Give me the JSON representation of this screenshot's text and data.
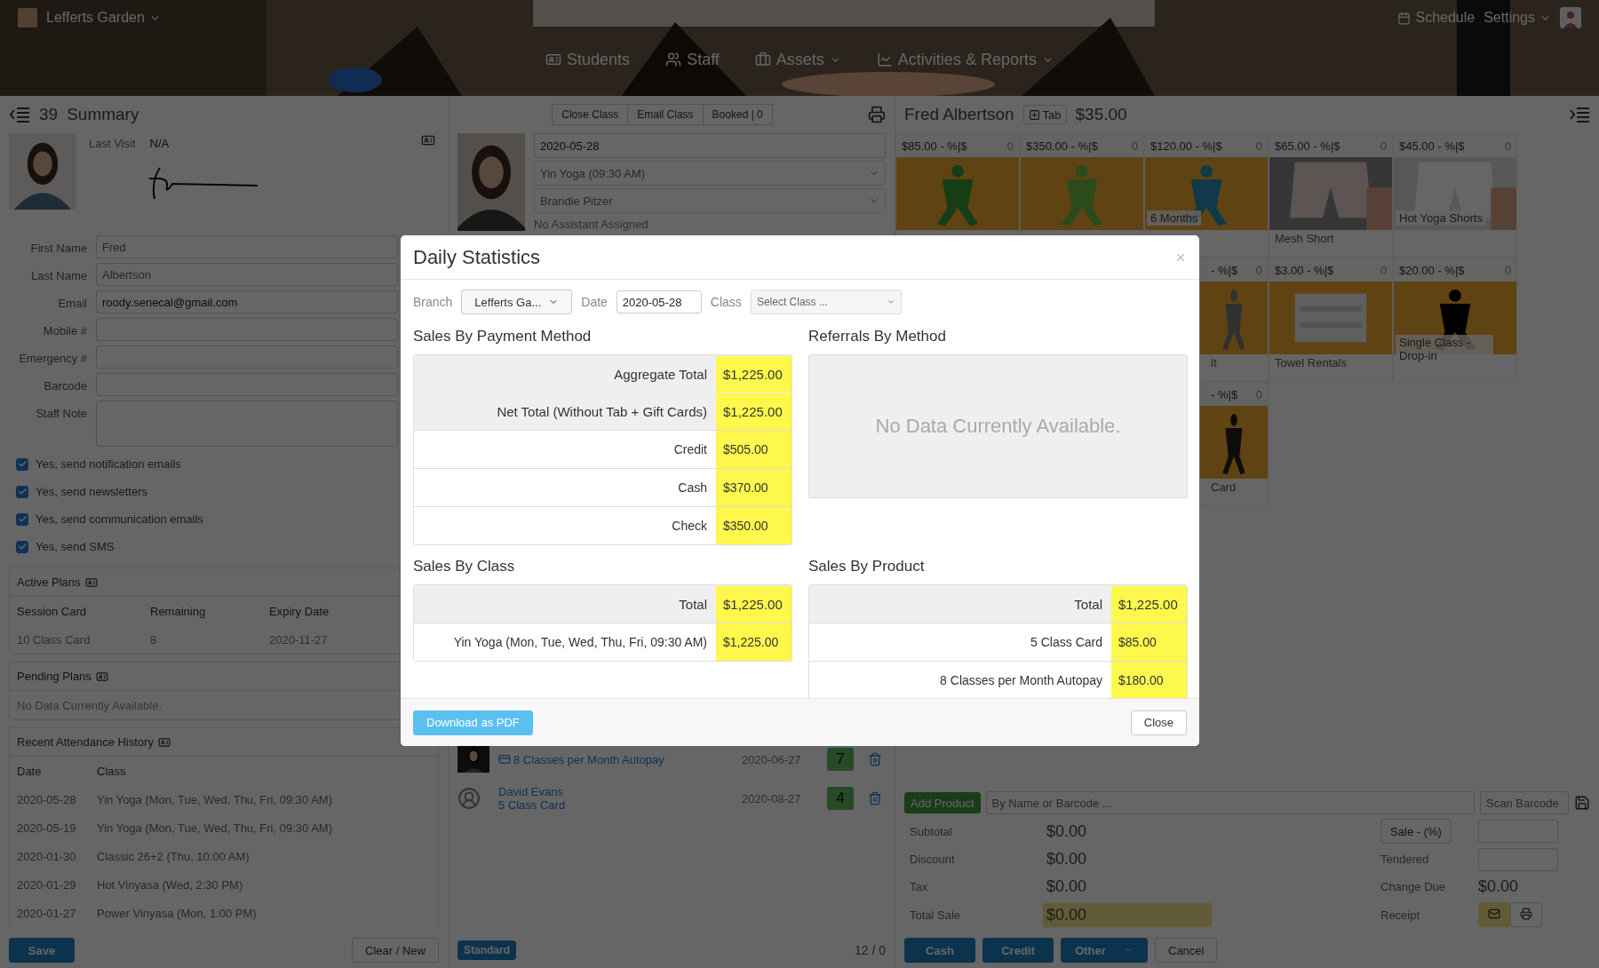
{
  "header": {
    "branch": "Lefferts Garden",
    "nav": [
      {
        "label": "Students",
        "dropdown": false
      },
      {
        "label": "Staff",
        "dropdown": false
      },
      {
        "label": "Assets",
        "dropdown": true
      },
      {
        "label": "Activities & Reports",
        "dropdown": true
      }
    ],
    "schedule": "Schedule",
    "settings": "Settings"
  },
  "summary": {
    "count": "39",
    "title": "Summary",
    "last_visit_label": "Last Visit",
    "last_visit": "N/A",
    "fields": [
      {
        "label": "First Name",
        "placeholder": "Fred"
      },
      {
        "label": "Last Name",
        "placeholder": "Albertson"
      },
      {
        "label": "Email",
        "value": "roody.senecal@gmail.com"
      },
      {
        "label": "Mobile #"
      },
      {
        "label": "Emergency #"
      },
      {
        "label": "Barcode"
      },
      {
        "label": "Staff Note",
        "kind": "textarea"
      }
    ],
    "options": [
      {
        "label": "Yes, send notification emails",
        "checked": true
      },
      {
        "label": "Yes, send newsletters",
        "checked": true
      },
      {
        "label": "Yes, send communication emails",
        "checked": true
      },
      {
        "label": "Yes, send SMS",
        "checked": true
      }
    ],
    "active_plans": {
      "title": "Active Plans",
      "columns": [
        "Session Card",
        "Remaining",
        "Expiry Date"
      ],
      "rows": [
        [
          "10 Class Card",
          "8",
          "2020-11-27"
        ]
      ]
    },
    "pending_plans": {
      "title": "Pending Plans",
      "empty": "No Data Currently Available."
    },
    "attendance": {
      "title": "Recent Attendance History",
      "columns": [
        "Date",
        "Class"
      ],
      "rows": [
        [
          "2020-05-28",
          "Yin Yoga (Mon, Tue, Wed, Thu, Fri, 09:30 AM)"
        ],
        [
          "2020-05-19",
          "Yin Yoga (Mon, Tue, Wed, Thu, Fri, 09:30 AM)"
        ],
        [
          "2020-01-30",
          "Classic 26+2 (Thu, 10:00 AM)"
        ],
        [
          "2020-01-29",
          "Hot Vinyasa (Wed, 2:30 PM)"
        ],
        [
          "2020-01-27",
          "Power Vinyasa (Mon, 1:00 PM)"
        ]
      ]
    },
    "save": "Save",
    "clear": "Clear / New"
  },
  "class_panel": {
    "buttons": [
      "Close Class",
      "Email Class",
      "Booked | 0"
    ],
    "date": "2020-05-28",
    "class": "Yin Yoga (09:30 AM)",
    "instructor": "Brandie Pitzer",
    "assistant": "No Assistant Assigned",
    "attendees": [
      {
        "plan": "8 Classes per Month Autopay",
        "card_icon": true,
        "date": "2020-06-27",
        "count": "7"
      },
      {
        "kind": "silhouette",
        "name": "David Evans",
        "plan": "5 Class Card",
        "card_icon": false,
        "date": "2020-08-27",
        "count": "4"
      }
    ],
    "mode": "Standard",
    "tally": "12 / 0"
  },
  "sale": {
    "customer": "Fred Albertson",
    "tab": "Tab",
    "balance": "$35.00",
    "product_rows": [
      [
        {
          "kind": "full",
          "price": "$85.00",
          "discount": "- %|$",
          "qty": "0"
        },
        {
          "kind": "full",
          "price": "$350.00",
          "discount": "- %|$",
          "qty": "0"
        },
        {
          "kind": "full",
          "price": "$120.00",
          "discount": "- %|$",
          "qty": "0",
          "caption": "6 Months"
        },
        {
          "kind": "full",
          "price": "$65.00",
          "discount": "- %|$",
          "qty": "0",
          "name": "Mesh Short"
        },
        {
          "kind": "full",
          "price": "$45.00",
          "discount": "- %|$",
          "qty": "0",
          "caption": "Hot Yoga Shorts"
        }
      ],
      [
        {
          "kind": "hidden"
        },
        {
          "kind": "hidden"
        },
        {
          "kind": "partial",
          "discount": "- %|$",
          "qty": "0",
          "name": "lt"
        },
        {
          "kind": "full",
          "price": "$3.00",
          "discount": "- %|$",
          "qty": "0",
          "name": "Towel Rentals"
        },
        {
          "kind": "full",
          "price": "$20.00",
          "discount": "- %|$",
          "qty": "0",
          "caption": "Single Class - Drop-in"
        }
      ],
      [
        {
          "kind": "hidden"
        },
        {
          "kind": "hidden"
        },
        {
          "kind": "partial",
          "discount": "- %|$",
          "qty": "0",
          "name": "Card"
        }
      ]
    ],
    "add_product": "Add Product",
    "search_placeholder": "By Name or Barcode ...",
    "scan_placeholder": "Scan Barcode",
    "totals": [
      {
        "label": "Subtotal",
        "value": "$0.00",
        "highlight": false
      },
      {
        "label": "Discount",
        "value": "$0.00",
        "highlight": false
      },
      {
        "label": "Tax",
        "value": "$0.00",
        "highlight": false
      },
      {
        "label": "Total Sale",
        "value": "$0.00",
        "highlight": true
      }
    ],
    "sale_button": "Sale - (%)",
    "tendered": "Tendered",
    "change_due": "Change Due",
    "change": "$0.00",
    "receipt": "Receipt",
    "pay_buttons": [
      "Cash",
      "Credit",
      "Other"
    ],
    "cancel": "Cancel"
  },
  "modal": {
    "title": "Daily Statistics",
    "branch_label": "Branch",
    "branch": "Lefferts Ga...",
    "date_label": "Date",
    "date": "2020-05-28",
    "class_label": "Class",
    "class_placeholder": "Select Class ...",
    "sections": [
      {
        "title": "Sales By Payment Method",
        "kind": "table",
        "rows": [
          {
            "label": "Aggregate Total",
            "value": "$1,225.00",
            "summary": true
          },
          {
            "label": "Net Total (Without Tab + Gift Cards)",
            "value": "$1,225.00",
            "summary": true
          },
          {
            "label": "Credit",
            "value": "$505.00",
            "summary": false
          },
          {
            "label": "Cash",
            "value": "$370.00",
            "summary": false
          },
          {
            "label": "Check",
            "value": "$350.00",
            "summary": false
          }
        ]
      },
      {
        "title": "Referrals By Method",
        "kind": "empty",
        "empty": "No Data Currently Available."
      },
      {
        "title": "Sales By Class",
        "kind": "table",
        "rows": [
          {
            "label": "Total",
            "value": "$1,225.00",
            "summary": true
          },
          {
            "label": "Yin Yoga (Mon, Tue, Wed, Thu, Fri, 09:30 AM)",
            "value": "$1,225.00",
            "summary": false
          }
        ]
      },
      {
        "title": "Sales By Product",
        "kind": "table",
        "rows": [
          {
            "label": "Total",
            "value": "$1,225.00",
            "summary": true
          },
          {
            "label": "5 Class Card",
            "value": "$85.00",
            "summary": false
          },
          {
            "label": "8 Classes per Month Autopay",
            "value": "$180.00",
            "summary": false
          }
        ]
      }
    ],
    "download": "Download as PDF",
    "close": "Close"
  }
}
